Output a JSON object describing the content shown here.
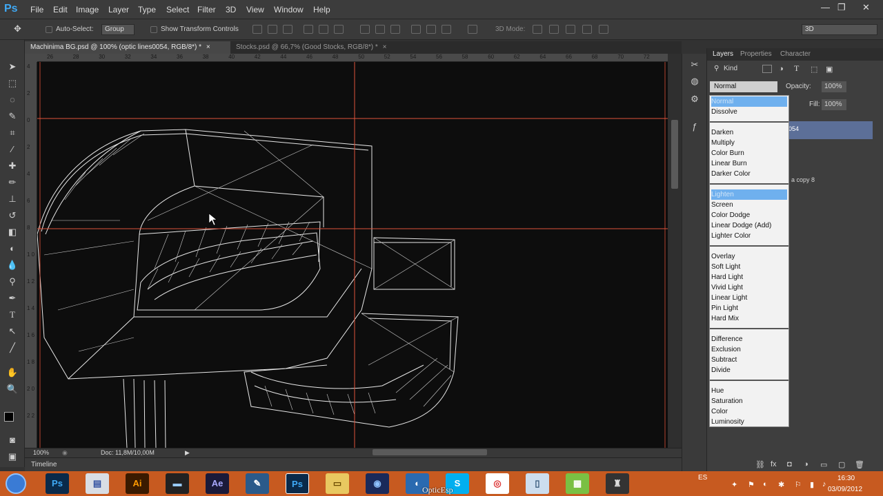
{
  "app": {
    "logo": "Ps"
  },
  "menu": [
    "File",
    "Edit",
    "Image",
    "Layer",
    "Type",
    "Select",
    "Filter",
    "3D",
    "View",
    "Window",
    "Help"
  ],
  "window_controls": [
    "—",
    "❐",
    "✕"
  ],
  "options_bar": {
    "auto_select_label": "Auto-Select:",
    "auto_select_value": "Group",
    "show_transform_label": "Show Transform Controls",
    "mode_3d_label": "3D Mode:",
    "workspace": "3D"
  },
  "tabs": [
    {
      "label": "Machinima BG.psd @ 100% (optic lines0054, RGB/8*) *",
      "close": "×"
    },
    {
      "label": "Stocks.psd @ 66,7% (Good Stocks, RGB/8*) *",
      "close": "×"
    }
  ],
  "ruler_top": [
    "26",
    "28",
    "30",
    "32",
    "34",
    "36",
    "38",
    "40",
    "42",
    "44",
    "46",
    "48",
    "50",
    "52",
    "54",
    "56",
    "58",
    "60",
    "62",
    "64",
    "66",
    "68",
    "70",
    "72"
  ],
  "ruler_left": [
    "4",
    "2",
    "0",
    "2",
    "4",
    "6",
    "8",
    "1 0",
    "1 2",
    "1 4",
    "1 6",
    "1 8",
    "2 0",
    "2 2"
  ],
  "status": {
    "zoom": "100%",
    "doc": "Doc: 11,8M/10,00M"
  },
  "timeline_label": "Timeline",
  "layers_panel": {
    "tabs": [
      "Layers",
      "Properties",
      "Character"
    ],
    "filter_kind": "Kind",
    "blend_mode": "Normal",
    "opacity_label": "Opacity:",
    "opacity_value": "100%",
    "fill_label": "Fill:",
    "fill_value": "100%",
    "layer_snippets": [
      "054",
      "a copy 8"
    ]
  },
  "blend_dropdown": {
    "items": [
      {
        "label": "Normal",
        "highlighted": true
      },
      {
        "label": "Dissolve"
      },
      {
        "sep": true
      },
      {
        "label": "Darken"
      },
      {
        "label": "Multiply"
      },
      {
        "label": "Color Burn"
      },
      {
        "label": "Linear Burn"
      },
      {
        "label": "Darker Color"
      },
      {
        "sep": true
      },
      {
        "label": "Lighten",
        "highlighted": true
      },
      {
        "label": "Screen"
      },
      {
        "label": "Color Dodge"
      },
      {
        "label": "Linear Dodge (Add)"
      },
      {
        "label": "Lighter Color"
      },
      {
        "sep": true
      },
      {
        "label": "Overlay"
      },
      {
        "label": "Soft Light"
      },
      {
        "label": "Hard Light"
      },
      {
        "label": "Vivid Light"
      },
      {
        "label": "Linear Light"
      },
      {
        "label": "Pin Light"
      },
      {
        "label": "Hard Mix"
      },
      {
        "sep": true
      },
      {
        "label": "Difference"
      },
      {
        "label": "Exclusion"
      },
      {
        "label": "Subtract"
      },
      {
        "label": "Divide"
      },
      {
        "sep": true
      },
      {
        "label": "Hue"
      },
      {
        "label": "Saturation"
      },
      {
        "label": "Color"
      },
      {
        "label": "Luminosity"
      }
    ]
  },
  "taskbar": {
    "apps": [
      "Ps",
      "Ai",
      "Ae",
      "Ps"
    ],
    "caption": "OpticEsp",
    "lang": "ES",
    "time": "16:30",
    "date": "03/09/2012"
  },
  "colors": {
    "guide": "#e0533a",
    "taskbar": "#c75a20",
    "highlight": "#6fb0ee",
    "selected_layer": "#5c6f98"
  }
}
